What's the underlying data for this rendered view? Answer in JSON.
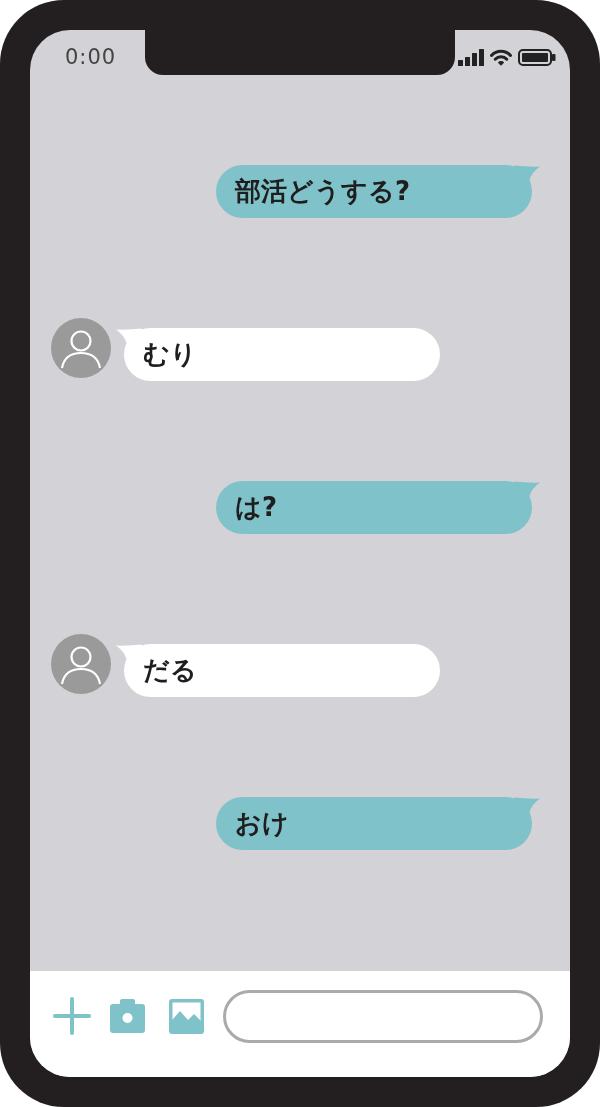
{
  "status_bar": {
    "time": "0:00"
  },
  "messages": [
    {
      "kind": "outgoing",
      "text": "部活どうする?"
    },
    {
      "kind": "incoming",
      "text": "むり"
    },
    {
      "kind": "outgoing",
      "text": "は?"
    },
    {
      "kind": "incoming",
      "text": "だる"
    },
    {
      "kind": "outgoing",
      "text": "おけ"
    }
  ]
}
